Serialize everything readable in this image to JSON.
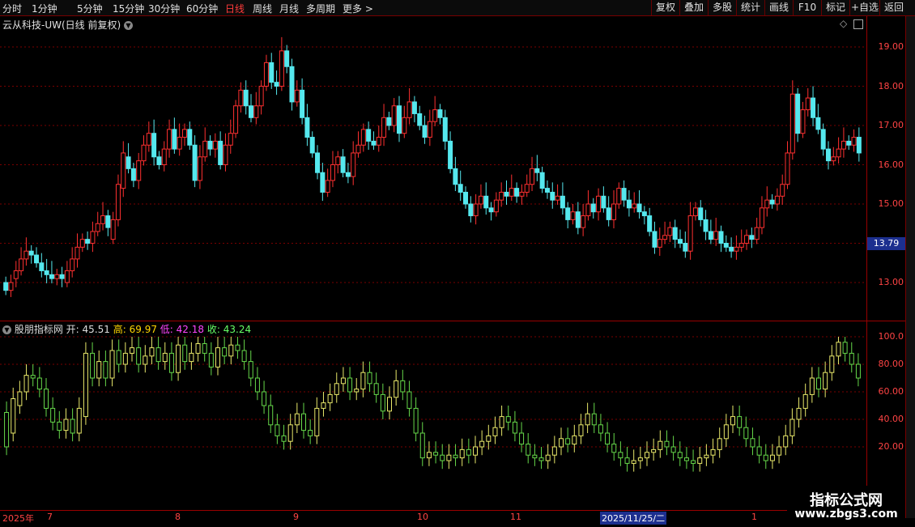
{
  "toolbar": {
    "periods": [
      "分时",
      "1分钟",
      "5分钟",
      "15分钟",
      "30分钟",
      "60分钟",
      "日线",
      "周线",
      "月线",
      "多周期",
      "更多 >"
    ],
    "active_period": "日线",
    "actions": [
      "复权",
      "叠加",
      "多股",
      "统计",
      "画线",
      "F10",
      "标记",
      "+自选",
      "返回"
    ]
  },
  "main_panel": {
    "title": "云从科技-UW(日线 前复权)",
    "current_price": "13.79",
    "y_ticks": [
      "19.00",
      "18.00",
      "17.00",
      "16.00",
      "15.00",
      "13.00"
    ]
  },
  "indicator_panel": {
    "name": "股朋指标网",
    "open_label": "开:",
    "open_value": "45.51",
    "high_label": "高:",
    "high_value": "69.97",
    "low_label": "低:",
    "low_value": "42.18",
    "close_label": "收:",
    "close_value": "43.24",
    "y_ticks": [
      "100.0",
      "80.00",
      "60.00",
      "40.00",
      "20.00"
    ]
  },
  "date_axis": {
    "labels": [
      "2025年",
      "7",
      "8",
      "9",
      "10",
      "11",
      "1"
    ],
    "cursor_date": "2025/11/25/二"
  },
  "watermark": {
    "title": "指标公式网",
    "url": "www.zbgs3.com"
  },
  "colors": {
    "up": "#ff3030",
    "down": "#55e8ee",
    "grid": "#7a0000",
    "active": "#ff3b3b",
    "cursor_bg": "#1c2f8f"
  },
  "chart_data": {
    "type": "candlestick",
    "price_series": [
      {
        "o": 13.0,
        "c": 12.8
      },
      {
        "o": 12.8,
        "c": 13.0
      },
      {
        "o": 13.1,
        "c": 13.3
      },
      {
        "o": 13.3,
        "c": 13.6
      },
      {
        "o": 13.6,
        "c": 13.8
      },
      {
        "o": 13.8,
        "c": 13.7
      },
      {
        "o": 13.7,
        "c": 13.5
      },
      {
        "o": 13.5,
        "c": 13.3
      },
      {
        "o": 13.3,
        "c": 13.2
      },
      {
        "o": 13.2,
        "c": 13.1
      },
      {
        "o": 13.1,
        "c": 13.2
      },
      {
        "o": 13.2,
        "c": 13.1
      },
      {
        "o": 13.0,
        "c": 13.3
      },
      {
        "o": 13.3,
        "c": 13.6
      },
      {
        "o": 13.6,
        "c": 13.9
      },
      {
        "o": 13.9,
        "c": 14.1
      },
      {
        "o": 14.1,
        "c": 14.0
      },
      {
        "o": 14.0,
        "c": 14.3
      },
      {
        "o": 14.3,
        "c": 14.5
      },
      {
        "o": 14.5,
        "c": 14.7
      },
      {
        "o": 14.7,
        "c": 14.4
      },
      {
        "o": 14.1,
        "c": 14.6
      },
      {
        "o": 14.6,
        "c": 15.5
      },
      {
        "o": 15.4,
        "c": 16.3
      },
      {
        "o": 16.2,
        "c": 15.9
      },
      {
        "o": 15.9,
        "c": 15.6
      },
      {
        "o": 15.6,
        "c": 16.1
      },
      {
        "o": 16.1,
        "c": 16.5
      },
      {
        "o": 16.5,
        "c": 16.8
      },
      {
        "o": 16.8,
        "c": 16.2
      },
      {
        "o": 16.2,
        "c": 16.0
      },
      {
        "o": 16.0,
        "c": 16.4
      },
      {
        "o": 16.4,
        "c": 16.9
      },
      {
        "o": 16.9,
        "c": 16.4
      },
      {
        "o": 16.4,
        "c": 16.7
      },
      {
        "o": 16.7,
        "c": 16.9
      },
      {
        "o": 16.9,
        "c": 16.5
      },
      {
        "o": 16.5,
        "c": 15.6
      },
      {
        "o": 15.6,
        "c": 16.2
      },
      {
        "o": 16.2,
        "c": 16.6
      },
      {
        "o": 16.6,
        "c": 16.4
      },
      {
        "o": 16.4,
        "c": 16.6
      },
      {
        "o": 16.6,
        "c": 16.0
      },
      {
        "o": 16.0,
        "c": 16.5
      },
      {
        "o": 16.5,
        "c": 16.8
      },
      {
        "o": 16.8,
        "c": 17.5
      },
      {
        "o": 17.5,
        "c": 17.9
      },
      {
        "o": 17.9,
        "c": 17.5
      },
      {
        "o": 17.5,
        "c": 17.2
      },
      {
        "o": 17.2,
        "c": 17.5
      },
      {
        "o": 17.5,
        "c": 18.0
      },
      {
        "o": 18.0,
        "c": 18.6
      },
      {
        "o": 18.6,
        "c": 18.1
      },
      {
        "o": 18.1,
        "c": 18.0
      },
      {
        "o": 18.0,
        "c": 18.9
      },
      {
        "o": 18.9,
        "c": 18.5
      },
      {
        "o": 18.5,
        "c": 17.6
      },
      {
        "o": 17.6,
        "c": 17.9
      },
      {
        "o": 17.9,
        "c": 17.2
      },
      {
        "o": 17.2,
        "c": 16.7
      },
      {
        "o": 16.7,
        "c": 16.3
      },
      {
        "o": 16.3,
        "c": 15.8
      },
      {
        "o": 15.8,
        "c": 15.3
      },
      {
        "o": 15.3,
        "c": 15.6
      },
      {
        "o": 15.6,
        "c": 16.0
      },
      {
        "o": 16.0,
        "c": 16.2
      },
      {
        "o": 16.2,
        "c": 15.8
      },
      {
        "o": 15.8,
        "c": 15.7
      },
      {
        "o": 15.7,
        "c": 16.3
      },
      {
        "o": 16.3,
        "c": 16.5
      },
      {
        "o": 16.5,
        "c": 16.9
      },
      {
        "o": 16.9,
        "c": 16.6
      },
      {
        "o": 16.6,
        "c": 16.5
      },
      {
        "o": 16.5,
        "c": 16.7
      },
      {
        "o": 16.7,
        "c": 17.2
      },
      {
        "o": 17.2,
        "c": 17.0
      },
      {
        "o": 17.0,
        "c": 17.5
      },
      {
        "o": 17.5,
        "c": 16.8
      },
      {
        "o": 16.8,
        "c": 17.2
      },
      {
        "o": 17.2,
        "c": 17.6
      },
      {
        "o": 17.6,
        "c": 17.3
      },
      {
        "o": 17.3,
        "c": 17.0
      },
      {
        "o": 17.0,
        "c": 16.7
      },
      {
        "o": 16.7,
        "c": 17.1
      },
      {
        "o": 17.1,
        "c": 17.4
      },
      {
        "o": 17.4,
        "c": 17.2
      },
      {
        "o": 17.2,
        "c": 16.6
      },
      {
        "o": 16.6,
        "c": 15.9
      },
      {
        "o": 15.9,
        "c": 15.5
      },
      {
        "o": 15.5,
        "c": 15.3
      },
      {
        "o": 15.3,
        "c": 15.0
      },
      {
        "o": 15.0,
        "c": 14.7
      },
      {
        "o": 14.7,
        "c": 15.0
      },
      {
        "o": 15.0,
        "c": 15.2
      },
      {
        "o": 15.2,
        "c": 14.9
      },
      {
        "o": 14.9,
        "c": 14.8
      },
      {
        "o": 14.8,
        "c": 15.1
      },
      {
        "o": 15.1,
        "c": 15.3
      },
      {
        "o": 15.3,
        "c": 15.2
      },
      {
        "o": 15.2,
        "c": 15.4
      },
      {
        "o": 15.4,
        "c": 15.2
      },
      {
        "o": 15.2,
        "c": 15.3
      },
      {
        "o": 15.3,
        "c": 15.5
      },
      {
        "o": 15.5,
        "c": 15.9
      },
      {
        "o": 15.9,
        "c": 15.8
      },
      {
        "o": 15.8,
        "c": 15.4
      },
      {
        "o": 15.4,
        "c": 15.3
      },
      {
        "o": 15.3,
        "c": 15.1
      },
      {
        "o": 15.1,
        "c": 15.2
      },
      {
        "o": 15.2,
        "c": 14.9
      },
      {
        "o": 14.9,
        "c": 14.6
      },
      {
        "o": 14.6,
        "c": 14.8
      },
      {
        "o": 14.8,
        "c": 14.4
      },
      {
        "o": 14.4,
        "c": 14.7
      },
      {
        "o": 14.7,
        "c": 15.0
      },
      {
        "o": 15.0,
        "c": 14.8
      },
      {
        "o": 14.8,
        "c": 15.2
      },
      {
        "o": 15.2,
        "c": 14.9
      },
      {
        "o": 14.9,
        "c": 14.6
      },
      {
        "o": 14.6,
        "c": 15.0
      },
      {
        "o": 15.0,
        "c": 15.4
      },
      {
        "o": 15.4,
        "c": 15.1
      },
      {
        "o": 15.1,
        "c": 14.9
      },
      {
        "o": 14.9,
        "c": 15.0
      },
      {
        "o": 15.0,
        "c": 14.8
      },
      {
        "o": 14.8,
        "c": 14.7
      },
      {
        "o": 14.7,
        "c": 14.3
      },
      {
        "o": 14.3,
        "c": 13.9
      },
      {
        "o": 13.9,
        "c": 14.1
      },
      {
        "o": 14.1,
        "c": 14.2
      },
      {
        "o": 14.2,
        "c": 14.4
      },
      {
        "o": 14.4,
        "c": 14.1
      },
      {
        "o": 14.1,
        "c": 14.0
      },
      {
        "o": 14.0,
        "c": 13.8
      },
      {
        "o": 13.8,
        "c": 14.7
      },
      {
        "o": 14.7,
        "c": 14.9
      },
      {
        "o": 14.9,
        "c": 14.6
      },
      {
        "o": 14.6,
        "c": 14.3
      },
      {
        "o": 14.3,
        "c": 14.1
      },
      {
        "o": 14.1,
        "c": 14.3
      },
      {
        "o": 14.3,
        "c": 14.0
      },
      {
        "o": 14.0,
        "c": 13.9
      },
      {
        "o": 13.9,
        "c": 13.8
      },
      {
        "o": 13.8,
        "c": 13.9
      },
      {
        "o": 13.9,
        "c": 14.0
      },
      {
        "o": 14.0,
        "c": 14.2
      },
      {
        "o": 14.2,
        "c": 14.1
      },
      {
        "o": 14.1,
        "c": 14.4
      },
      {
        "o": 14.4,
        "c": 14.9
      },
      {
        "o": 14.9,
        "c": 15.1
      },
      {
        "o": 15.1,
        "c": 15.0
      },
      {
        "o": 15.0,
        "c": 15.2
      },
      {
        "o": 15.2,
        "c": 15.5
      },
      {
        "o": 15.5,
        "c": 16.3
      },
      {
        "o": 16.3,
        "c": 17.8
      },
      {
        "o": 17.8,
        "c": 16.8
      },
      {
        "o": 16.8,
        "c": 17.4
      },
      {
        "o": 17.4,
        "c": 17.7
      },
      {
        "o": 17.7,
        "c": 17.2
      },
      {
        "o": 17.2,
        "c": 16.9
      },
      {
        "o": 16.9,
        "c": 16.4
      },
      {
        "o": 16.4,
        "c": 16.1
      },
      {
        "o": 16.1,
        "c": 16.2
      },
      {
        "o": 16.2,
        "c": 16.4
      },
      {
        "o": 16.4,
        "c": 16.6
      },
      {
        "o": 16.6,
        "c": 16.5
      },
      {
        "o": 16.5,
        "c": 16.7
      },
      {
        "o": 16.7,
        "c": 16.3
      }
    ],
    "indicator_series": [
      {
        "o": 45,
        "c": 20
      },
      {
        "o": 30,
        "c": 55
      },
      {
        "o": 50,
        "c": 60
      },
      {
        "o": 60,
        "c": 72
      },
      {
        "o": 72,
        "c": 70
      },
      {
        "o": 70,
        "c": 62
      },
      {
        "o": 62,
        "c": 48
      },
      {
        "o": 48,
        "c": 38
      },
      {
        "o": 38,
        "c": 32
      },
      {
        "o": 32,
        "c": 40
      },
      {
        "o": 40,
        "c": 30
      },
      {
        "o": 30,
        "c": 48
      },
      {
        "o": 42,
        "c": 88
      },
      {
        "o": 88,
        "c": 70
      },
      {
        "o": 70,
        "c": 82
      },
      {
        "o": 82,
        "c": 70
      },
      {
        "o": 70,
        "c": 90
      },
      {
        "o": 90,
        "c": 80
      },
      {
        "o": 80,
        "c": 88
      },
      {
        "o": 88,
        "c": 92
      },
      {
        "o": 92,
        "c": 80
      },
      {
        "o": 80,
        "c": 86
      },
      {
        "o": 86,
        "c": 92
      },
      {
        "o": 92,
        "c": 82
      },
      {
        "o": 82,
        "c": 88
      },
      {
        "o": 88,
        "c": 74
      },
      {
        "o": 74,
        "c": 94
      },
      {
        "o": 94,
        "c": 82
      },
      {
        "o": 82,
        "c": 88
      },
      {
        "o": 88,
        "c": 95
      },
      {
        "o": 95,
        "c": 88
      },
      {
        "o": 88,
        "c": 78
      },
      {
        "o": 78,
        "c": 92
      },
      {
        "o": 92,
        "c": 86
      },
      {
        "o": 86,
        "c": 94
      },
      {
        "o": 94,
        "c": 90
      },
      {
        "o": 90,
        "c": 82
      },
      {
        "o": 82,
        "c": 70
      },
      {
        "o": 70,
        "c": 60
      },
      {
        "o": 60,
        "c": 50
      },
      {
        "o": 50,
        "c": 36
      },
      {
        "o": 36,
        "c": 28
      },
      {
        "o": 28,
        "c": 24
      },
      {
        "o": 24,
        "c": 36
      },
      {
        "o": 36,
        "c": 44
      },
      {
        "o": 44,
        "c": 32
      },
      {
        "o": 32,
        "c": 28
      },
      {
        "o": 28,
        "c": 48
      },
      {
        "o": 48,
        "c": 52
      },
      {
        "o": 52,
        "c": 58
      },
      {
        "o": 58,
        "c": 66
      },
      {
        "o": 66,
        "c": 70
      },
      {
        "o": 70,
        "c": 60
      },
      {
        "o": 60,
        "c": 62
      },
      {
        "o": 62,
        "c": 74
      },
      {
        "o": 74,
        "c": 66
      },
      {
        "o": 66,
        "c": 58
      },
      {
        "o": 58,
        "c": 46
      },
      {
        "o": 46,
        "c": 56
      },
      {
        "o": 56,
        "c": 68
      },
      {
        "o": 68,
        "c": 60
      },
      {
        "o": 60,
        "c": 48
      },
      {
        "o": 48,
        "c": 30
      },
      {
        "o": 30,
        "c": 12
      },
      {
        "o": 12,
        "c": 16
      },
      {
        "o": 16,
        "c": 14
      },
      {
        "o": 14,
        "c": 10
      },
      {
        "o": 10,
        "c": 14
      },
      {
        "o": 14,
        "c": 12
      },
      {
        "o": 12,
        "c": 18
      },
      {
        "o": 18,
        "c": 14
      },
      {
        "o": 14,
        "c": 20
      },
      {
        "o": 20,
        "c": 24
      },
      {
        "o": 24,
        "c": 28
      },
      {
        "o": 28,
        "c": 34
      },
      {
        "o": 34,
        "c": 42
      },
      {
        "o": 42,
        "c": 38
      },
      {
        "o": 38,
        "c": 30
      },
      {
        "o": 30,
        "c": 22
      },
      {
        "o": 22,
        "c": 14
      },
      {
        "o": 14,
        "c": 12
      },
      {
        "o": 12,
        "c": 10
      },
      {
        "o": 10,
        "c": 14
      },
      {
        "o": 14,
        "c": 20
      },
      {
        "o": 20,
        "c": 26
      },
      {
        "o": 26,
        "c": 22
      },
      {
        "o": 22,
        "c": 28
      },
      {
        "o": 28,
        "c": 36
      },
      {
        "o": 36,
        "c": 44
      },
      {
        "o": 44,
        "c": 36
      },
      {
        "o": 36,
        "c": 30
      },
      {
        "o": 30,
        "c": 22
      },
      {
        "o": 22,
        "c": 16
      },
      {
        "o": 16,
        "c": 12
      },
      {
        "o": 12,
        "c": 8
      },
      {
        "o": 8,
        "c": 10
      },
      {
        "o": 10,
        "c": 12
      },
      {
        "o": 12,
        "c": 16
      },
      {
        "o": 16,
        "c": 18
      },
      {
        "o": 18,
        "c": 24
      },
      {
        "o": 24,
        "c": 20
      },
      {
        "o": 20,
        "c": 16
      },
      {
        "o": 16,
        "c": 12
      },
      {
        "o": 12,
        "c": 10
      },
      {
        "o": 10,
        "c": 8
      },
      {
        "o": 8,
        "c": 12
      },
      {
        "o": 12,
        "c": 14
      },
      {
        "o": 14,
        "c": 18
      },
      {
        "o": 18,
        "c": 26
      },
      {
        "o": 26,
        "c": 36
      },
      {
        "o": 36,
        "c": 42
      },
      {
        "o": 42,
        "c": 34
      },
      {
        "o": 34,
        "c": 26
      },
      {
        "o": 26,
        "c": 20
      },
      {
        "o": 20,
        "c": 14
      },
      {
        "o": 14,
        "c": 10
      },
      {
        "o": 10,
        "c": 14
      },
      {
        "o": 14,
        "c": 20
      },
      {
        "o": 20,
        "c": 28
      },
      {
        "o": 28,
        "c": 40
      },
      {
        "o": 40,
        "c": 48
      },
      {
        "o": 48,
        "c": 58
      },
      {
        "o": 58,
        "c": 70
      },
      {
        "o": 70,
        "c": 62
      },
      {
        "o": 62,
        "c": 74
      },
      {
        "o": 74,
        "c": 86
      },
      {
        "o": 86,
        "c": 96
      },
      {
        "o": 96,
        "c": 88
      },
      {
        "o": 88,
        "c": 80
      },
      {
        "o": 80,
        "c": 70
      }
    ],
    "ylim": [
      12.4,
      19.6
    ],
    "indicator_ylim": [
      0,
      105
    ]
  }
}
